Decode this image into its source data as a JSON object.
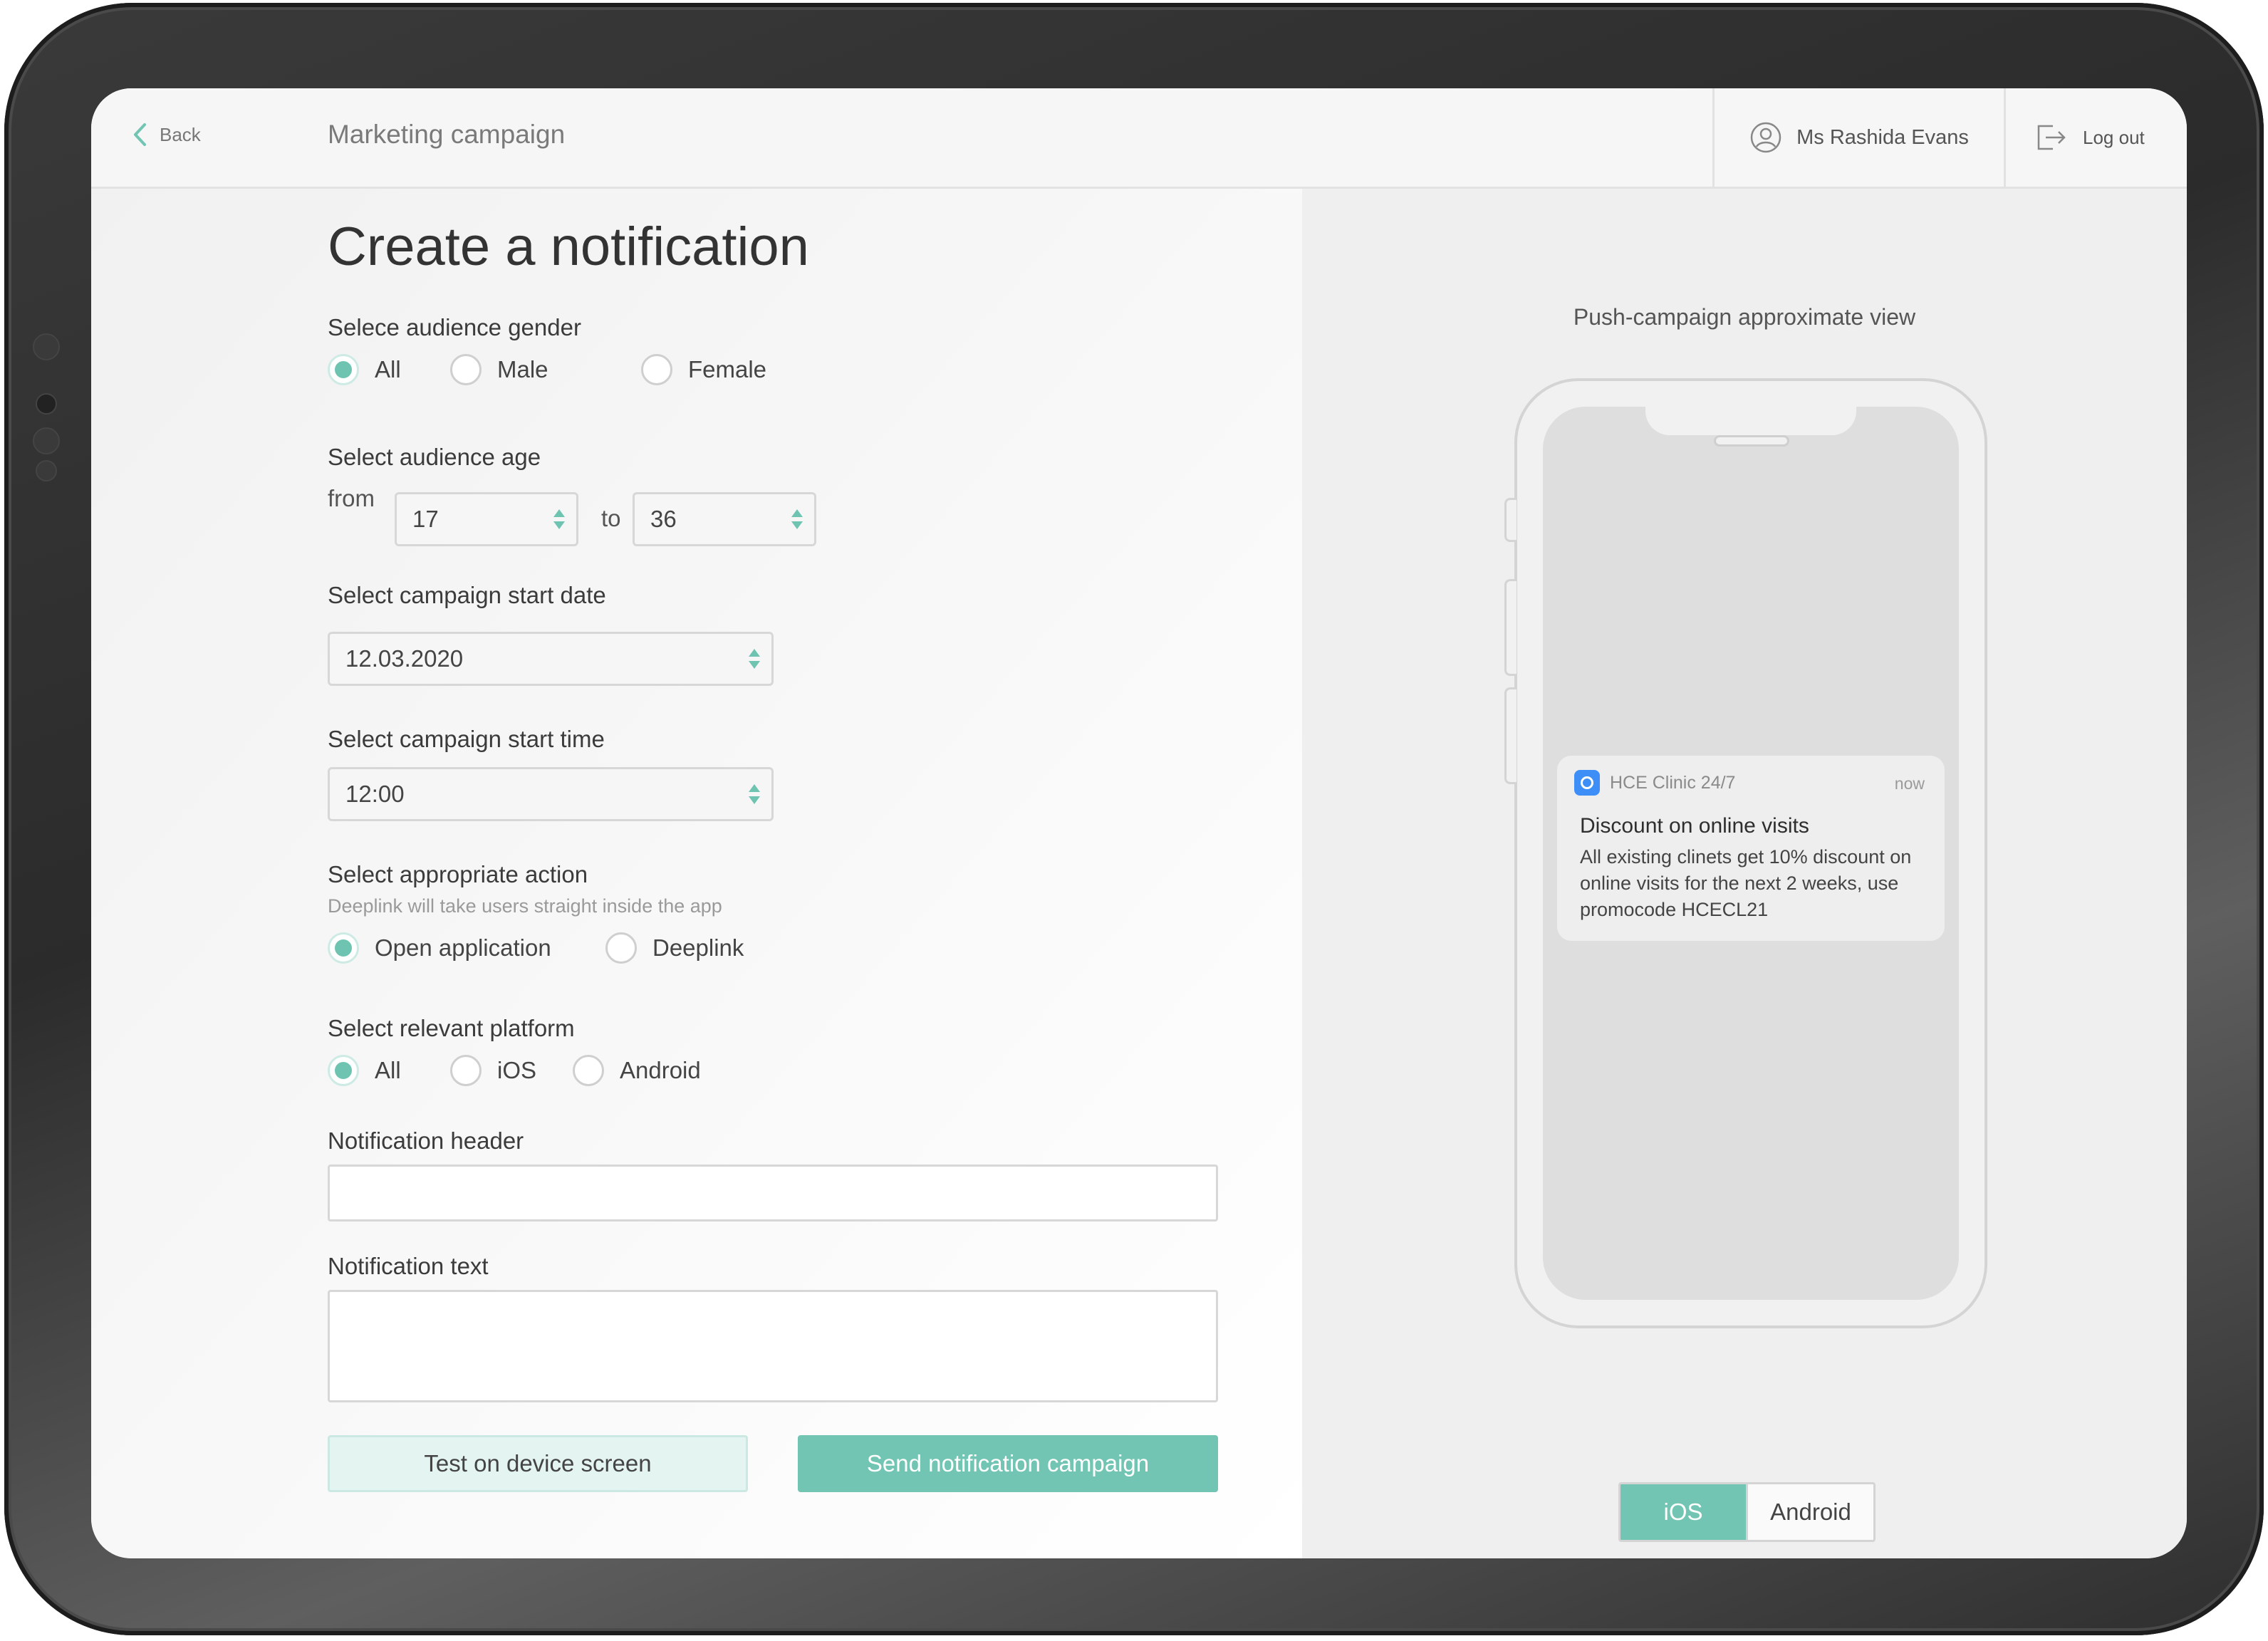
{
  "header": {
    "back_label": "Back",
    "page_title": "Marketing campaign",
    "user_name": "Ms Rashida Evans",
    "logout_label": "Log out"
  },
  "form": {
    "title": "Create a notification",
    "gender": {
      "label": "Selece audience gender",
      "options": [
        "All",
        "Male",
        "Female"
      ],
      "selected": "All"
    },
    "age": {
      "label": "Select audience age",
      "from_label": "from",
      "from_value": "17",
      "to_label": "to",
      "to_value": "36"
    },
    "start_date": {
      "label": "Select campaign start date",
      "value": "12.03.2020"
    },
    "start_time": {
      "label": "Select campaign start time",
      "value": "12:00"
    },
    "action": {
      "label": "Select appropriate action",
      "hint": "Deeplink will take users straight inside the app",
      "options": [
        "Open application",
        "Deeplink"
      ],
      "selected": "Open application"
    },
    "platform": {
      "label": "Select relevant platform",
      "options": [
        "All",
        "iOS",
        "Android"
      ],
      "selected": "All"
    },
    "notification_header": {
      "label": "Notification header",
      "value": ""
    },
    "notification_text": {
      "label": "Notification text",
      "value": ""
    },
    "test_button": "Test on device screen",
    "send_button": "Send notification campaign"
  },
  "preview": {
    "title": "Push-campaign approximate view",
    "notification": {
      "app_name": "HCE Clinic 24/7",
      "time": "now",
      "title": "Discount on online visits",
      "body": "All existing clinets get 10% discount on online visits for the next 2 weeks, use promocode HCECL21"
    },
    "platform_toggle": [
      "iOS",
      "Android"
    ],
    "platform_selected": "iOS"
  },
  "colors": {
    "accent": "#72c5b3",
    "accent_light": "#e4f5f1",
    "app_icon": "#3e8ef7"
  }
}
